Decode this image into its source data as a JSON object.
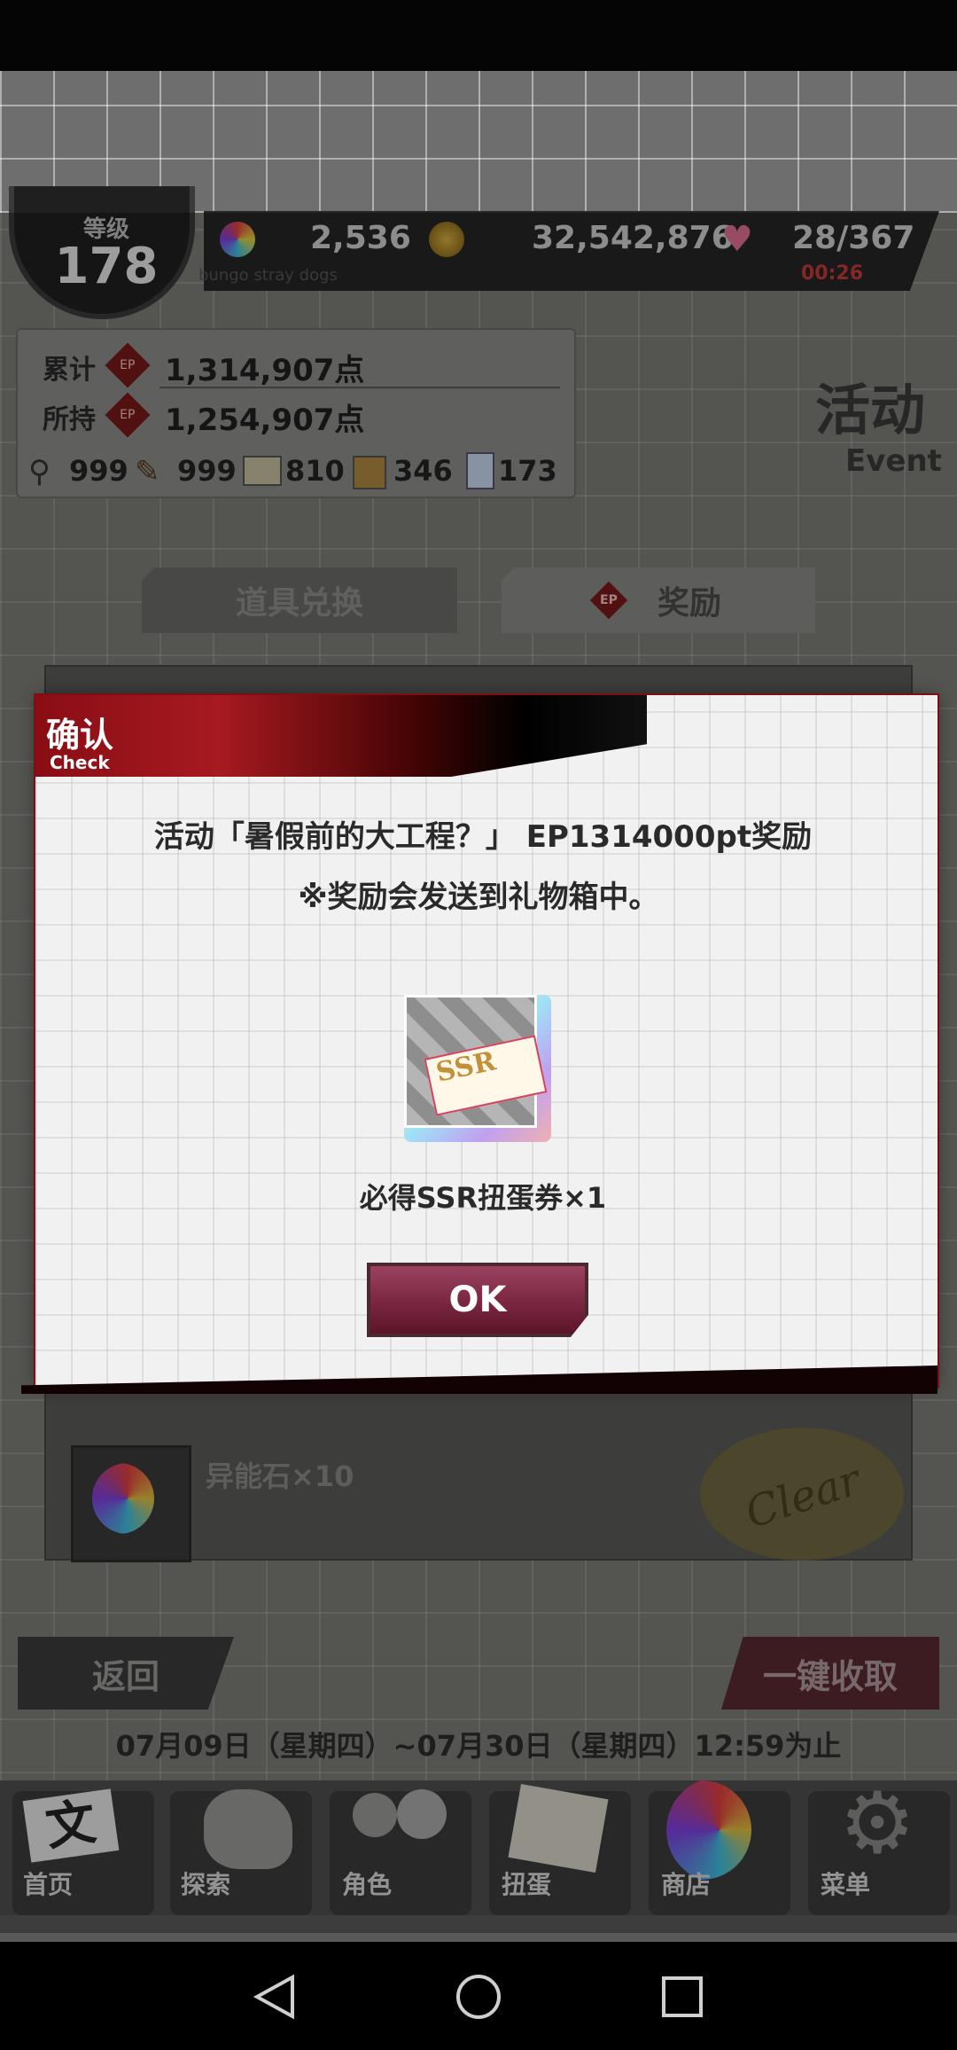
{
  "hud": {
    "level_label": "等级",
    "level_value": "178",
    "gems": "2,536",
    "coins": "32,542,876",
    "stamina": "28/367",
    "stamina_timer": "00:26",
    "subtitle": "bungo stray dogs"
  },
  "points": {
    "total_label": "累计",
    "total_value": "1,314,907点",
    "owned_label": "所持",
    "owned_value": "1,254,907点",
    "ep_badge": "EP",
    "inventory": [
      "999",
      "999",
      "810",
      "346",
      "173"
    ]
  },
  "event": {
    "title": "活动",
    "subtitle": "Event"
  },
  "tabs": {
    "exchange": "道具兑换",
    "reward": "奖励"
  },
  "list": {
    "reward_text": "异能石×10",
    "clear_stamp": "Clear"
  },
  "dialog": {
    "title": "确认",
    "title_en": "Check",
    "message_line1": "活动「暑假前的大工程？」 EP1314000pt奖励",
    "message_line2": "※奖励会发送到礼物箱中。",
    "ticket_text": "SSR",
    "item_name": "必得SSR扭蛋券×1",
    "ok_label": "OK"
  },
  "footer": {
    "back_label": "返回",
    "collect_label": "一键收取",
    "date_range": "07月09日（星期四）~07月30日（星期四）12:59为止"
  },
  "nav": [
    {
      "label": "首页"
    },
    {
      "label": "探索"
    },
    {
      "label": "角色"
    },
    {
      "label": "扭蛋"
    },
    {
      "label": "商店"
    },
    {
      "label": "菜单"
    }
  ],
  "system_nav": {
    "icons": [
      "back-icon",
      "home-icon",
      "recents-icon"
    ]
  }
}
